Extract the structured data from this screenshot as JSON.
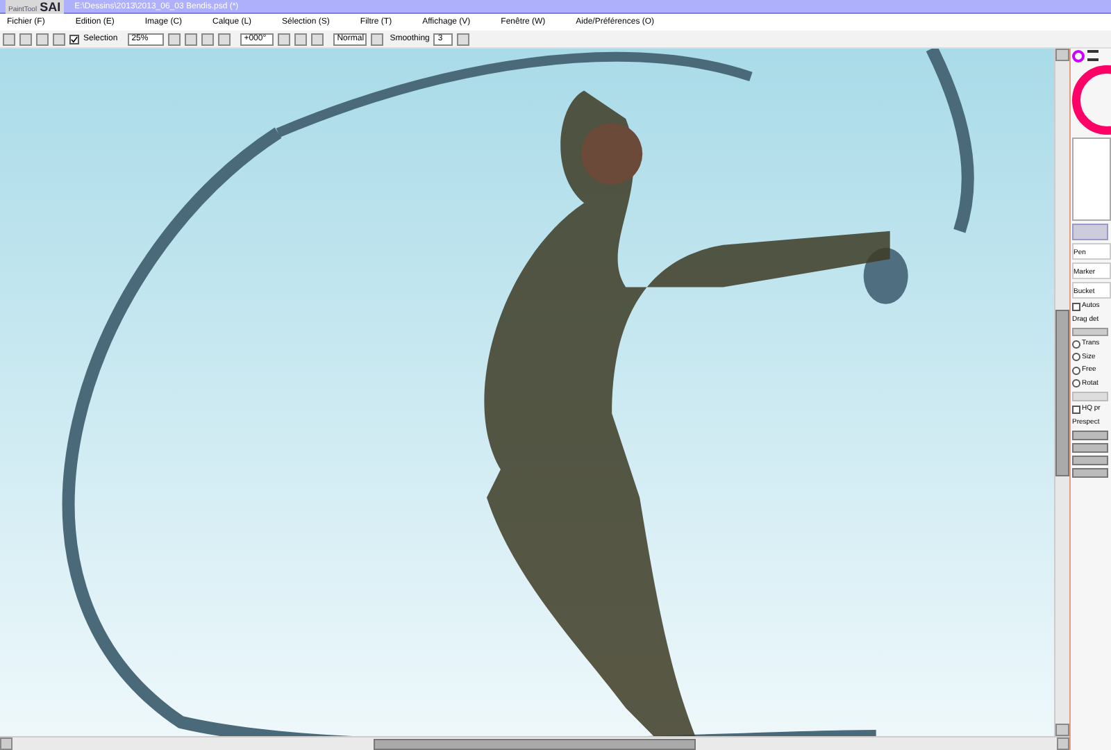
{
  "window": {
    "logo_small": "PaintTool",
    "logo": "SAI",
    "title": "E:\\Dessins\\2013\\2013_06_03 Bendis.psd (*)"
  },
  "menu": [
    {
      "label": "Fichier (F)"
    },
    {
      "label": "Edition (E)"
    },
    {
      "label": "Image (C)"
    },
    {
      "label": "Calque (L)"
    },
    {
      "label": "Sélection (S)"
    },
    {
      "label": "Filtre (T)"
    },
    {
      "label": "Affichage (V)"
    },
    {
      "label": "Fenêtre (W)"
    },
    {
      "label": "Aide/Préférences (O)"
    }
  ],
  "toolbar": {
    "selection": {
      "label": "Selection",
      "checked": true
    },
    "zoom": "25%",
    "rotation": "+000°",
    "blend": "Normal",
    "smoothing_label": "Smoothing",
    "smoothing": "3"
  },
  "panel": {
    "tools": [
      {
        "label": "Pen"
      },
      {
        "label": "Marker"
      },
      {
        "label": "Bucket"
      }
    ],
    "auto": {
      "label": "Autos",
      "checked": false
    },
    "drag_label": "Drag det",
    "modes": [
      {
        "label": "Trans",
        "selected": false
      },
      {
        "label": "Size",
        "selected": false
      },
      {
        "label": "Free",
        "selected": false
      },
      {
        "label": "Rotat",
        "selected": false
      }
    ],
    "hq": {
      "label": "HQ pr",
      "checked": false
    },
    "perspective_label": "Prespect"
  }
}
